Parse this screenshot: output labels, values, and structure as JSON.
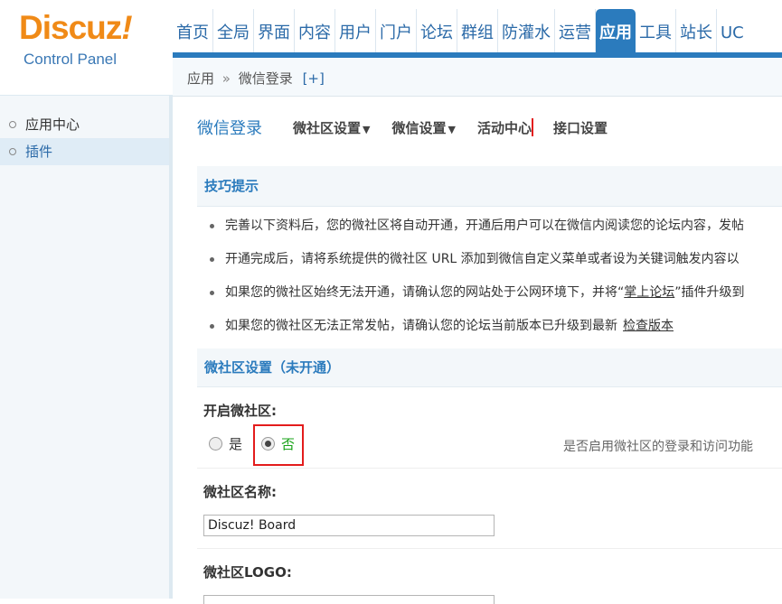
{
  "logo": {
    "brand": "Discuz",
    "bang": "!",
    "subtitle": "Control Panel"
  },
  "colors": {
    "brand_orange": "#f08a17",
    "accent_blue": "#2b7bbd",
    "cp_blue": "#3a78b5",
    "highlight_red": "#e31c1c",
    "selected_green": "#19a319"
  },
  "top_nav": {
    "items": [
      "首页",
      "全局",
      "界面",
      "内容",
      "用户",
      "门户",
      "论坛",
      "群组",
      "防灌水",
      "运营",
      "应用",
      "工具",
      "站长",
      "UC"
    ],
    "active": "应用"
  },
  "breadcrumb": {
    "root": "应用",
    "sep": "»",
    "current": "微信登录",
    "add": "[+]"
  },
  "sidebar": {
    "items": [
      {
        "label": "应用中心"
      },
      {
        "label": "插件"
      }
    ]
  },
  "subnav": {
    "title": "微信登录",
    "tabs": [
      {
        "label": "微社区设置",
        "caret": "▼"
      },
      {
        "label": "微信设置",
        "caret": "▼"
      },
      {
        "label": "活动中心"
      },
      {
        "label": "接口设置"
      }
    ]
  },
  "tips": {
    "title": "技巧提示",
    "items": [
      "完善以下资料后，您的微社区将自动开通，开通后用户可以在微信内阅读您的论坛内容，发帖",
      "开通完成后，请将系统提供的微社区 URL 添加到微信自定义菜单或者设为关键词触发内容以",
      "如果您的微社区始终无法开通，请确认您的网站处于公网环境下，并将“",
      "如果您的微社区无法正常发帖，请确认您的论坛当前版本已升级到最新"
    ],
    "item3_link": "掌上论坛",
    "item3_tail": "”插件升级到",
    "item4_link": "检查版本"
  },
  "settings": {
    "section_title": "微社区设置（未开通）",
    "enable": {
      "label": "开启微社区:",
      "yes": "是",
      "no": "否",
      "selected": "否",
      "hint": "是否启用微社区的登录和访问功能"
    },
    "name": {
      "label": "微社区名称:",
      "value": "Discuz! Board"
    },
    "logo": {
      "label": "微社区LOGO:"
    }
  }
}
